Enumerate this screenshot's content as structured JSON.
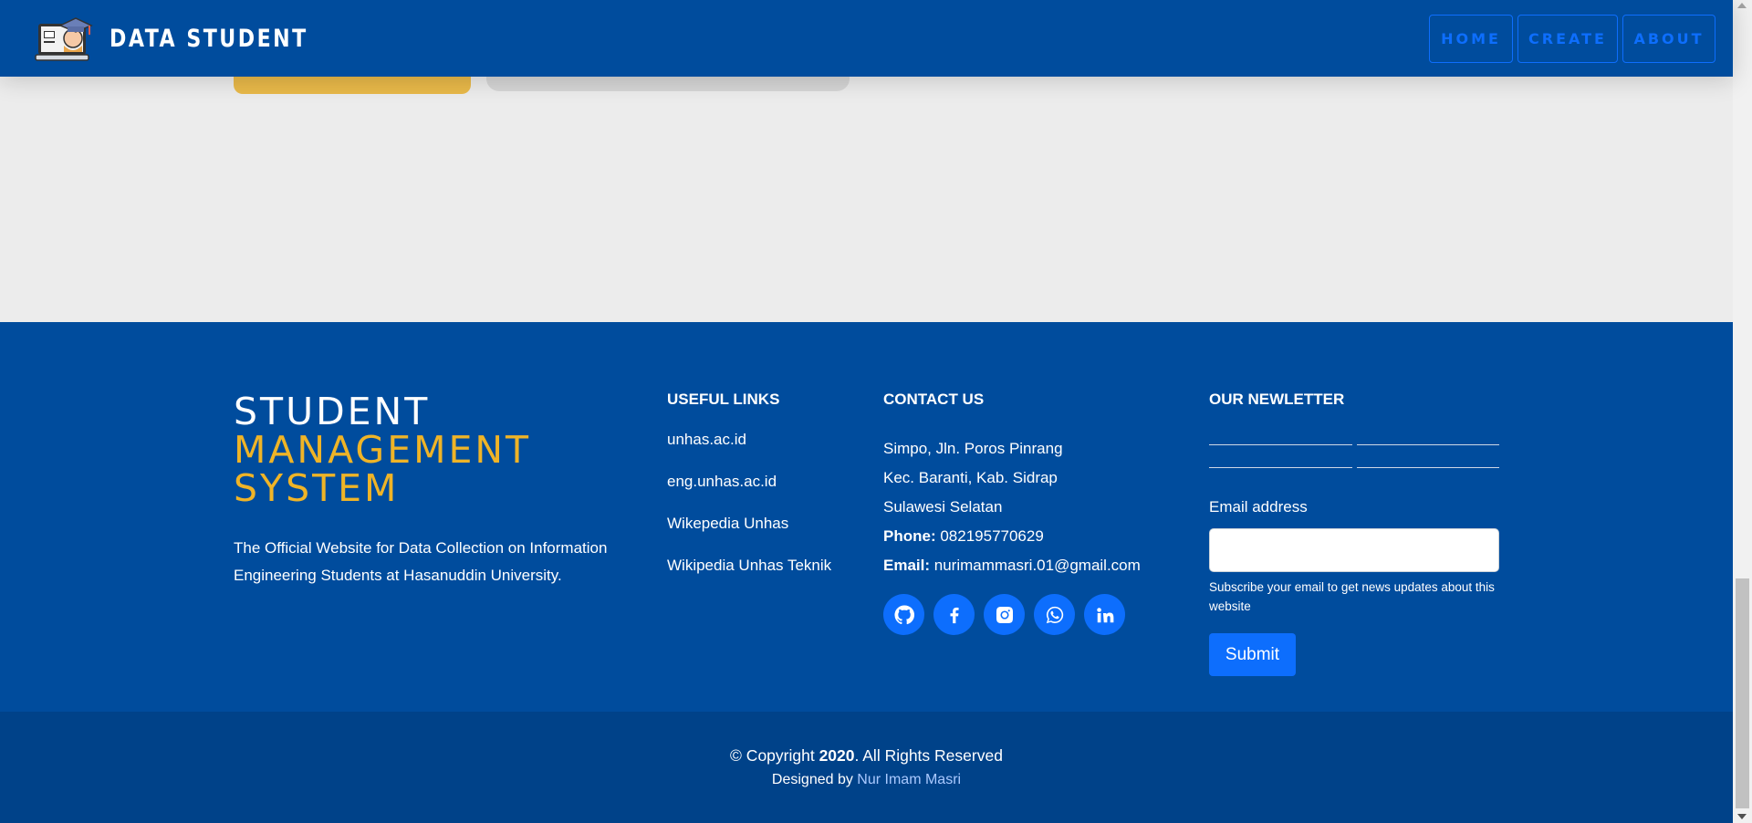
{
  "navbar": {
    "brand": "DATA STUDENT",
    "logo_icon": "student-laptop-logo",
    "links": [
      "HOME",
      "CREATE",
      "ABOUT"
    ]
  },
  "footer": {
    "title_line1": "STUDENT",
    "title_line2": "MANAGEMENT",
    "title_line3": "SYSTEM",
    "description": "The Official Website for Data Collection on Information Engineering Students at Hasanuddin University.",
    "useful_links": {
      "title": "USEFUL LINKS",
      "items": [
        "unhas.ac.id",
        "eng.unhas.ac.id",
        "Wikepedia Unhas",
        "Wikipedia Unhas Teknik"
      ]
    },
    "contact": {
      "title": "CONTACT US",
      "address1": "Simpo, Jln. Poros Pinrang",
      "address2": "Kec. Baranti, Kab. Sidrap",
      "address3": "Sulawesi Selatan",
      "phone_label": "Phone:",
      "phone": "082195770629",
      "email_label": "Email:",
      "email": "nurimammasri.01@gmail.com",
      "socials": [
        "github-icon",
        "facebook-icon",
        "instagram-icon",
        "whatsapp-icon",
        "linkedin-icon"
      ]
    },
    "newsletter": {
      "title": "OUR NEWLETTER",
      "email_label": "Email address",
      "email_value": "",
      "help": "Subscribe your email to get news updates about this website",
      "submit": "Submit"
    },
    "copyright_prefix": "© Copyright ",
    "copyright_year": "2020",
    "copyright_suffix": ". All Rights Reserved",
    "designed_prefix": "Designed by ",
    "designed_author": "Nur Imam Masri"
  },
  "colors": {
    "primary": "#004c9d",
    "accent_yellow": "#efb427",
    "button_blue": "#0d6efd"
  }
}
